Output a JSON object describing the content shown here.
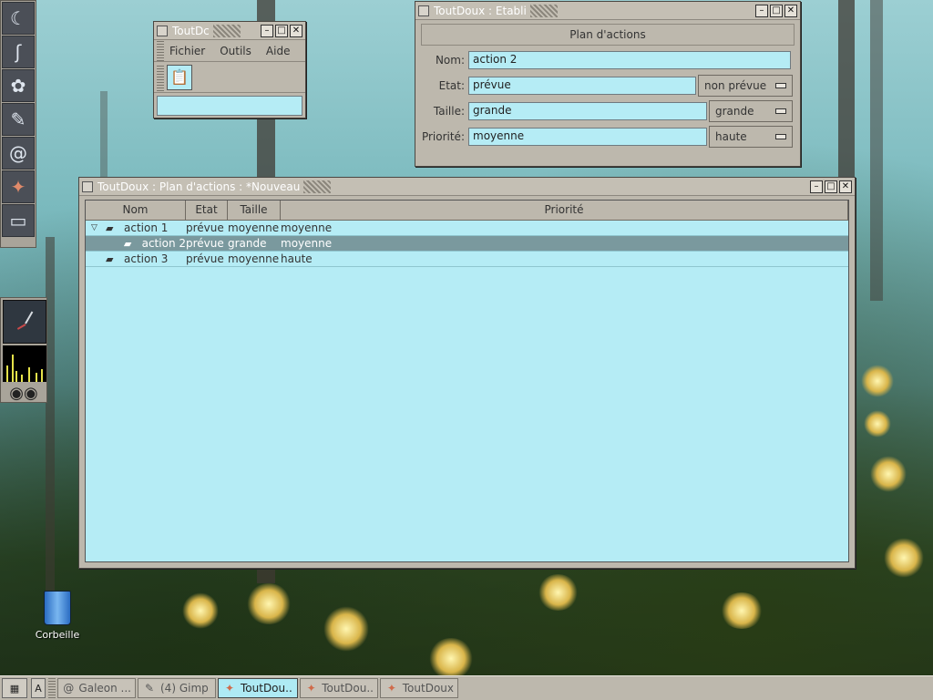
{
  "desktop": {
    "trash_label": "Corbeille"
  },
  "small_window": {
    "title": "ToutDc",
    "menu": [
      "Fichier",
      "Outils",
      "Aide"
    ],
    "tool_icon": "notebook-icon"
  },
  "edit_window": {
    "title": "ToutDoux : Etabli",
    "section": "Plan d'actions",
    "labels": {
      "nom": "Nom:",
      "etat": "Etat:",
      "taille": "Taille:",
      "priorite": "Priorité:"
    },
    "values": {
      "nom": "action 2",
      "etat": "prévue",
      "taille": "grande",
      "priorite": "moyenne"
    },
    "combos": {
      "etat": "non prévue",
      "taille": "grande",
      "priorite": "haute"
    }
  },
  "main_window": {
    "title": "ToutDoux : Plan d'actions : *Nouveau",
    "columns": [
      "Nom",
      "Etat",
      "Taille",
      "Priorité"
    ],
    "rows": [
      {
        "nom": "action 1",
        "etat": "prévue",
        "taille": "moyenne",
        "priorite": "moyenne",
        "level": 0,
        "expanded": true,
        "selected": false
      },
      {
        "nom": "action 2",
        "etat": "prévue",
        "taille": "grande",
        "priorite": "moyenne",
        "level": 1,
        "expanded": false,
        "selected": true
      },
      {
        "nom": "action 3",
        "etat": "prévue",
        "taille": "moyenne",
        "priorite": "haute",
        "level": 0,
        "expanded": false,
        "selected": false
      }
    ]
  },
  "taskbar": {
    "tasks": [
      {
        "label": "Galeon ...",
        "icon": "galeon-icon",
        "active": false
      },
      {
        "label": "(4) Gimp",
        "icon": "gimp-icon",
        "active": false
      },
      {
        "label": "ToutDou..",
        "icon": "toutdoux-icon",
        "active": true
      },
      {
        "label": "ToutDou..",
        "icon": "toutdoux-icon",
        "active": false
      },
      {
        "label": "ToutDoux",
        "icon": "toutdoux-icon",
        "active": false
      }
    ]
  }
}
